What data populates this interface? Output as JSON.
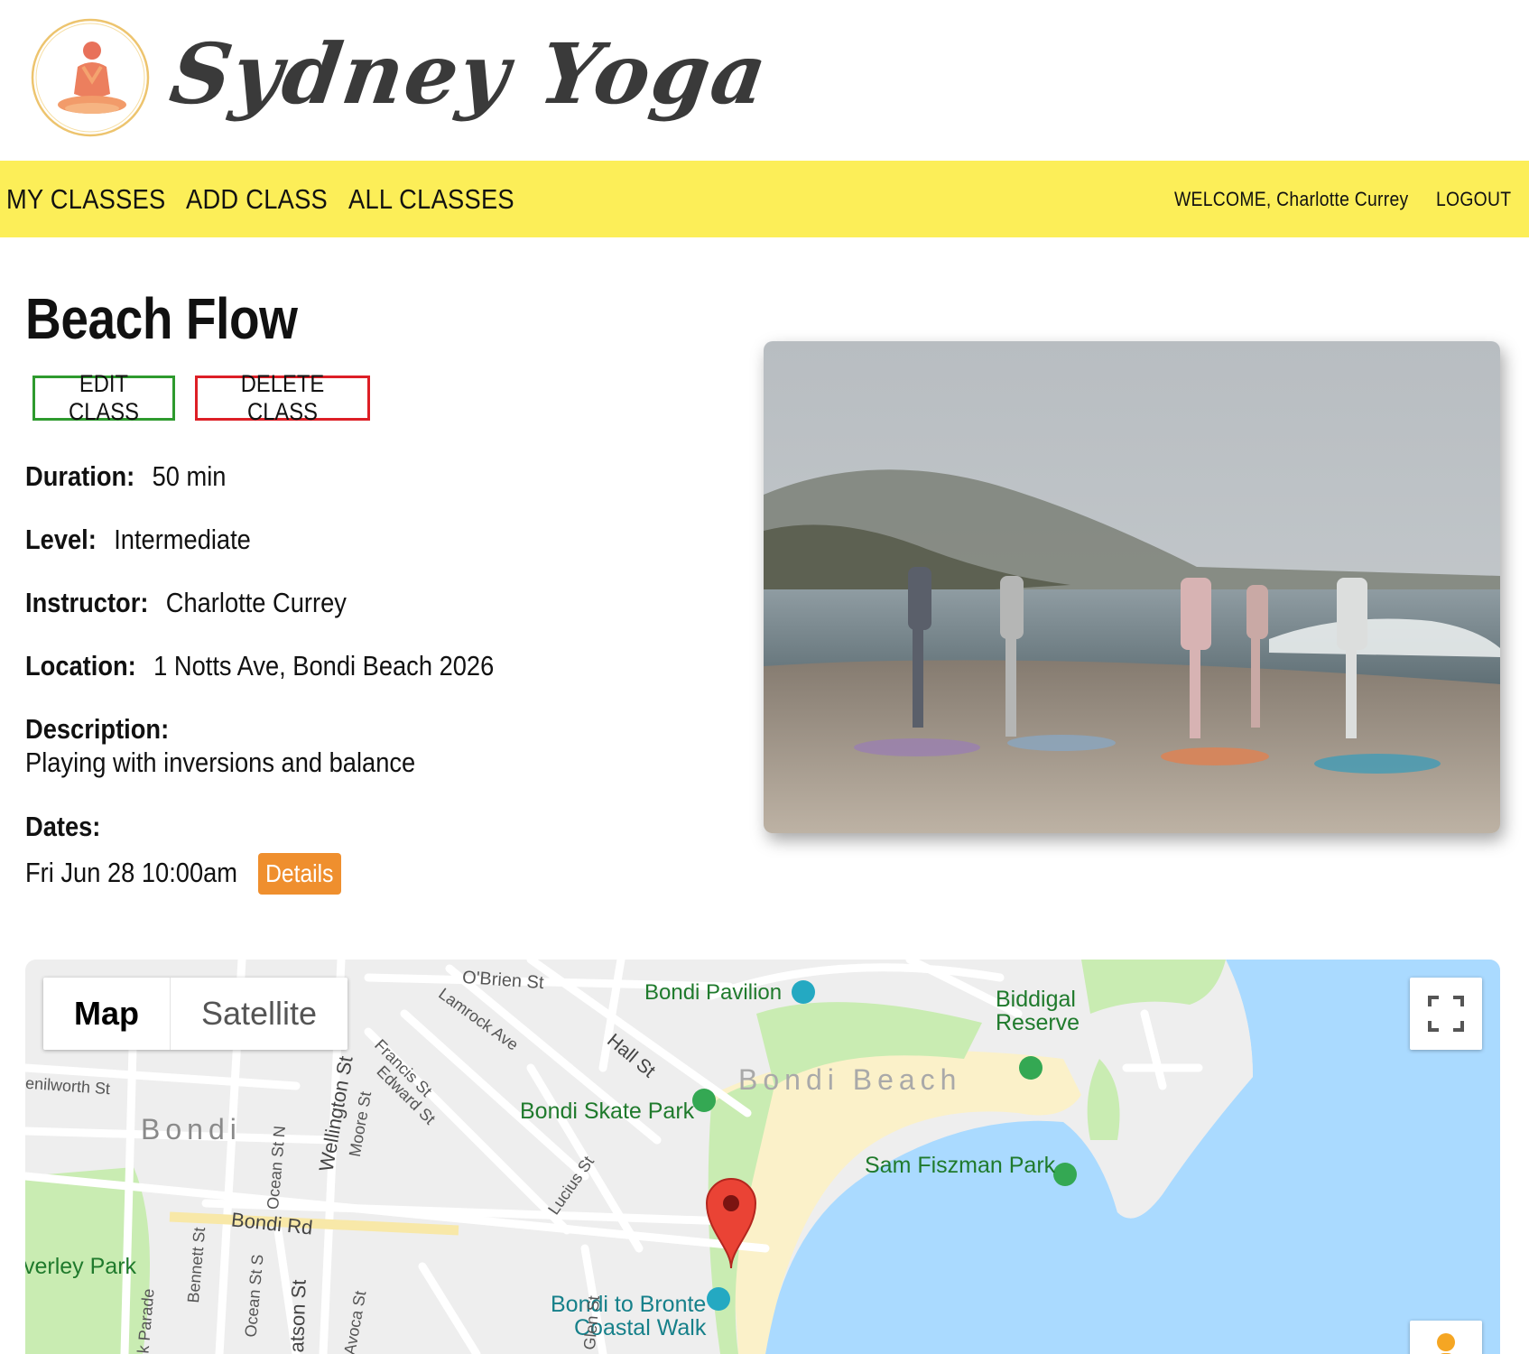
{
  "brand": {
    "name": "Sydney Yoga",
    "logo_icon": "meditating-person-icon"
  },
  "nav": {
    "my_classes": "MY CLASSES",
    "add_class": "ADD CLASS",
    "all_classes": "ALL CLASSES",
    "welcome": "WELCOME, Charlotte Currey",
    "logout": "LOGOUT"
  },
  "class": {
    "title": "Beach Flow",
    "edit_label": "EDIT CLASS",
    "delete_label": "DELETE CLASS",
    "duration_label": "Duration:",
    "duration": "50 min",
    "level_label": "Level:",
    "level": "Intermediate",
    "instructor_label": "Instructor:",
    "instructor": "Charlotte Currey",
    "location_label": "Location:",
    "location": "1 Notts Ave, Bondi Beach 2026",
    "description_label": "Description:",
    "description": "Playing with inversions and balance",
    "dates_label": "Dates:",
    "dates": [
      {
        "date": "Fri Jun 28 10:00am",
        "details_label": "Details"
      }
    ]
  },
  "colors": {
    "navbar": "#fcee58",
    "edit_border": "#2e9a2e",
    "delete_border": "#dd1f26",
    "details_button": "#ef8f2e"
  },
  "map": {
    "map_label": "Map",
    "satellite_label": "Satellite",
    "labels": {
      "bondi_pavilion": "Bondi Pavilion",
      "biddigal_reserve_1": "Biddigal",
      "biddigal_reserve_2": "Reserve",
      "bondi_beach": "Bondi Beach",
      "bondi_skate_park": "Bondi Skate Park",
      "sam_fiszman_park": "Sam Fiszman Park",
      "bondi_to_bronte_1": "Bondi to Bronte",
      "bondi_to_bronte_2": "Coastal Walk",
      "bondi": "Bondi",
      "bondi_rd": "Bondi Rd",
      "waverley_park": "verley Park",
      "obrien_st": "O'Brien St",
      "lamrock_ave": "Lamrock Ave",
      "hall_st": "Hall St",
      "francis_st": "Francis St",
      "edward_st": "Edward St",
      "wellington_st": "Wellington St",
      "moore_st": "Moore St",
      "ocean_st_n": "Ocean St N",
      "ocean_st_s": "Ocean St S",
      "bennett_st": "Bennett St",
      "watson_st": "atson St",
      "avoca_st": "Avoca St",
      "lucius_st": "Lucius St",
      "glen_st": "Glen St",
      "kenilworth_st": "enilworth St",
      "park_parade": "k Parade"
    }
  }
}
